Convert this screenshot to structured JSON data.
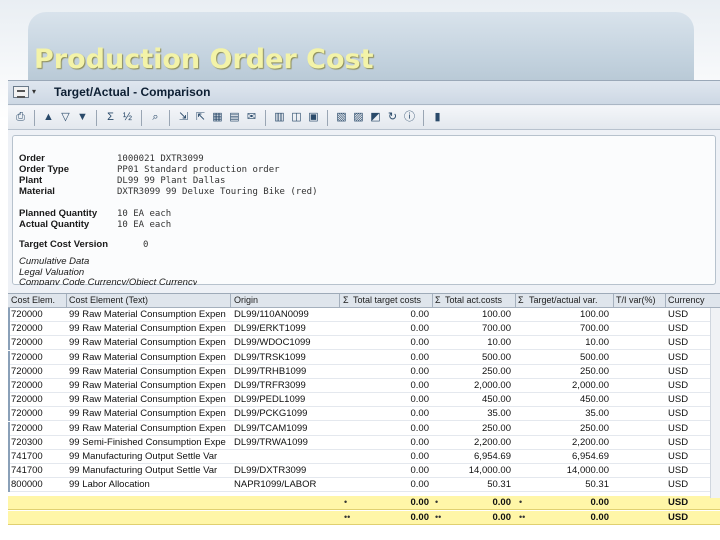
{
  "slide": {
    "title": "Production Order Cost"
  },
  "window": {
    "title": "Target/Actual - Comparison"
  },
  "toolbar": {
    "icons": [
      "print-icon",
      "sum-icon",
      "filter-icon",
      "filter-set-icon",
      "subtotal-icon",
      "export-icon",
      "find-icon",
      "layout-icon",
      "change-layout-icon",
      "save-layout-icon",
      "graphic-icon",
      "detail-icon",
      "columns-icon",
      "sort-up-icon",
      "sort-down-icon",
      "info-icon",
      "help-icon"
    ]
  },
  "header": {
    "fields": [
      {
        "label": "Order",
        "value": "1000021 DXTR3099"
      },
      {
        "label": "Order Type",
        "value": "PP01 Standard production order"
      },
      {
        "label": "Plant",
        "value": "DL99 99 Plant Dallas"
      },
      {
        "label": "Material",
        "value": "DXTR3099 99 Deluxe Touring Bike (red)"
      },
      {
        "label": "Planned Quantity",
        "value": "10 EA each"
      },
      {
        "label": "Actual Quantity",
        "value": "10 EA each"
      },
      {
        "label": "Target Cost Version",
        "value": "0"
      }
    ],
    "notes": [
      "Cumulative Data",
      "Legal Valuation",
      "Company Code Currency/Object Currency"
    ]
  },
  "table": {
    "columns": [
      "Cost Elem.",
      "Cost Element (Text)",
      "Origin",
      "Σ",
      "Total target costs",
      "Σ",
      "Total act.costs",
      "Σ",
      "Target/actual var.",
      "T/I var(%)",
      "Currency"
    ],
    "rows": [
      {
        "elem": "720000",
        "text": "99 Raw Material Consumption Expen",
        "origin": "DL99/110AN0099",
        "target": "0.00",
        "actual": "100.00",
        "var": "100.00",
        "pct": "",
        "cur": "USD"
      },
      {
        "elem": "720000",
        "text": "99 Raw Material Consumption Expen",
        "origin": "DL99/ERKT1099",
        "target": "0.00",
        "actual": "700.00",
        "var": "700.00",
        "pct": "",
        "cur": "USD"
      },
      {
        "elem": "720000",
        "text": "99 Raw Material Consumption Expen",
        "origin": "DL99/WDOC1099",
        "target": "0.00",
        "actual": "10.00",
        "var": "10.00",
        "pct": "",
        "cur": "USD"
      },
      {
        "elem": "720000",
        "text": "99 Raw Material Consumption Expen",
        "origin": "DL99/TRSK1099",
        "target": "0.00",
        "actual": "500.00",
        "var": "500.00",
        "pct": "",
        "cur": "USD"
      },
      {
        "elem": "720000",
        "text": "99 Raw Material Consumption Expen",
        "origin": "DL99/TRHB1099",
        "target": "0.00",
        "actual": "250.00",
        "var": "250.00",
        "pct": "",
        "cur": "USD"
      },
      {
        "elem": "720000",
        "text": "99 Raw Material Consumption Expen",
        "origin": "DL99/TRFR3099",
        "target": "0.00",
        "actual": "2,000.00",
        "var": "2,000.00",
        "pct": "",
        "cur": "USD"
      },
      {
        "elem": "720000",
        "text": "99 Raw Material Consumption Expen",
        "origin": "DL99/PEDL1099",
        "target": "0.00",
        "actual": "450.00",
        "var": "450.00",
        "pct": "",
        "cur": "USD"
      },
      {
        "elem": "720000",
        "text": "99 Raw Material Consumption Expen",
        "origin": "DL99/PCKG1099",
        "target": "0.00",
        "actual": "35.00",
        "var": "35.00",
        "pct": "",
        "cur": "USD"
      },
      {
        "elem": "720000",
        "text": "99 Raw Material Consumption Expen",
        "origin": "DL99/TCAM1099",
        "target": "0.00",
        "actual": "250.00",
        "var": "250.00",
        "pct": "",
        "cur": "USD"
      },
      {
        "elem": "720300",
        "text": "99 Semi-Finished Consumption Expe",
        "origin": "DL99/TRWA1099",
        "target": "0.00",
        "actual": "2,200.00",
        "var": "2,200.00",
        "pct": "",
        "cur": "USD"
      },
      {
        "elem": "741700",
        "text": "99 Manufacturing Output Settle Var",
        "origin": "",
        "target": "0.00",
        "actual": "6,954.69",
        "var": "6,954.69",
        "pct": "",
        "cur": "USD"
      },
      {
        "elem": "741700",
        "text": "99 Manufacturing Output Settle Var",
        "origin": "DL99/DXTR3099",
        "target": "0.00",
        "actual": "14,000.00",
        "var": "14,000.00",
        "pct": "",
        "cur": "USD"
      },
      {
        "elem": "800000",
        "text": "99 Labor Allocation",
        "origin": "NAPR1099/LABOR",
        "target": "0.00",
        "actual": "50.31",
        "var": "50.31",
        "pct": "",
        "cur": "USD"
      }
    ],
    "totals": [
      {
        "mark": "•",
        "target": "0.00",
        "actual": "0.00",
        "var": "0.00",
        "cur": "USD"
      },
      {
        "mark": "••",
        "target": "0.00",
        "actual": "0.00",
        "var": "0.00",
        "cur": "USD"
      }
    ]
  }
}
